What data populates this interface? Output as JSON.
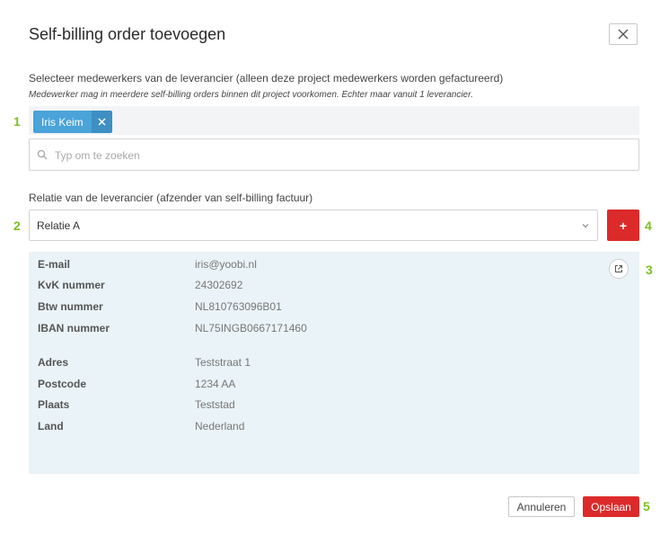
{
  "dialog": {
    "title": "Self-billing order toevoegen"
  },
  "employees": {
    "label": "Selecteer medewerkers van de leverancier (alleen deze project medewerkers worden gefactureerd)",
    "hint": "Medewerker mag in meerdere self-billing orders binnen dit project voorkomen. Echter maar vanuit 1 leverancier.",
    "selected": [
      "Iris Keim"
    ],
    "search_placeholder": "Typ om te zoeken"
  },
  "relation": {
    "label": "Relatie van de leverancier (afzender van self-billing factuur)",
    "selected": "Relatie A",
    "add_label": "+"
  },
  "details": {
    "rows": [
      {
        "key": "E-mail",
        "value": "iris@yoobi.nl"
      },
      {
        "key": "KvK nummer",
        "value": "24302692"
      },
      {
        "key": "Btw nummer",
        "value": "NL810763096B01"
      },
      {
        "key": "IBAN nummer",
        "value": "NL75INGB0667171460"
      },
      {
        "key": "Adres",
        "value": "Teststraat 1"
      },
      {
        "key": "Postcode",
        "value": "1234 AA"
      },
      {
        "key": "Plaats",
        "value": "Teststad"
      },
      {
        "key": "Land",
        "value": "Nederland"
      }
    ]
  },
  "footer": {
    "cancel_label": "Annuleren",
    "save_label": "Opslaan"
  },
  "markers": [
    "1",
    "2",
    "3",
    "4",
    "5"
  ],
  "icons": [
    "close-icon",
    "remove-icon",
    "search-icon",
    "chevron-down-icon",
    "external-link-icon"
  ],
  "colors": {
    "accent_red": "#dc2a2a",
    "chip_blue": "#4aa3d9",
    "marker_green": "#7bbf1f",
    "panel_bg": "#eaf3f7"
  }
}
